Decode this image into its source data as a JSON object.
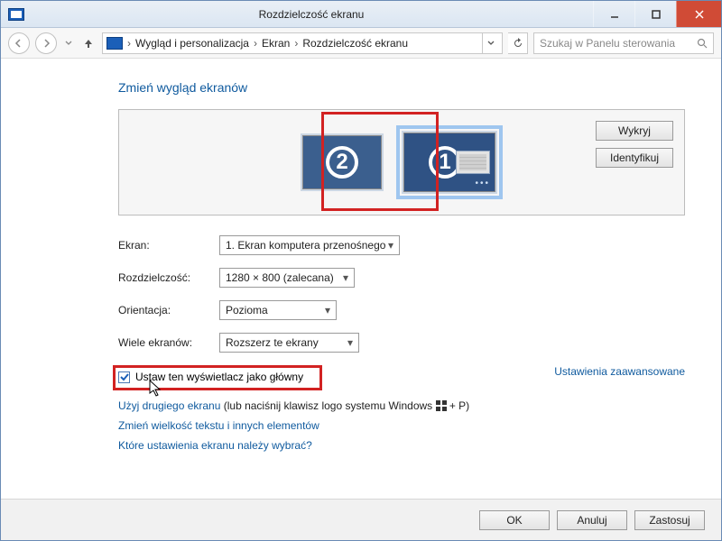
{
  "window": {
    "title": "Rozdzielczość ekranu"
  },
  "breadcrumb": {
    "item1": "Wygląd i personalizacja",
    "item2": "Ekran",
    "item3": "Rozdzielczość ekranu"
  },
  "search": {
    "placeholder": "Szukaj w Panelu sterowania"
  },
  "heading": "Zmień wygląd ekranów",
  "display_buttons": {
    "detect": "Wykryj",
    "identify": "Identyfikuj"
  },
  "monitors": {
    "primary_num": "1",
    "secondary_num": "2"
  },
  "form": {
    "screen_label": "Ekran:",
    "screen_value": "1. Ekran komputera przenośnego",
    "resolution_label": "Rozdzielczość:",
    "resolution_value": "1280 × 800 (zalecana)",
    "orientation_label": "Orientacja:",
    "orientation_value": "Pozioma",
    "multi_label": "Wiele ekranów:",
    "multi_value": "Rozszerz te ekrany",
    "primary_checkbox": "Ustaw ten wyświetlacz jako główny",
    "advanced_link": "Ustawienia zaawansowane"
  },
  "links": {
    "line1_a": "Użyj drugiego ekranu",
    "line1_b": " (lub naciśnij klawisz logo systemu Windows ",
    "line1_c": " + P)",
    "line2": "Zmień wielkość tekstu i innych elementów",
    "line3": "Które ustawienia ekranu należy wybrać?"
  },
  "footer": {
    "ok": "OK",
    "cancel": "Anuluj",
    "apply": "Zastosuj"
  }
}
